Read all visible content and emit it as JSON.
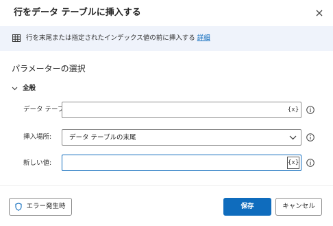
{
  "dialog": {
    "title": "行をデータ テーブルに挿入する",
    "close_icon": "close-icon"
  },
  "info": {
    "icon": "table-icon",
    "text": "行を末尾または指定されたインデックス値の前に挿入する",
    "link": "詳細"
  },
  "section": {
    "title": "パラメーターの選択"
  },
  "group": {
    "label": "全般",
    "icon": "chevron-down-icon"
  },
  "params": {
    "datatable": {
      "label": "データ テーブル:",
      "value": "",
      "var_button": "{x}"
    },
    "insert_location": {
      "label": "挿入場所:",
      "value": "データ テーブルの末尾"
    },
    "new_value": {
      "label": "新しい値:",
      "value": "",
      "var_button": "{x}"
    }
  },
  "footer": {
    "error_button": "エラー発生時",
    "save_button": "保存",
    "cancel_button": "キャンセル"
  },
  "colors": {
    "accent": "#0f6cbd",
    "info_bar_bg": "#eff3fb"
  }
}
